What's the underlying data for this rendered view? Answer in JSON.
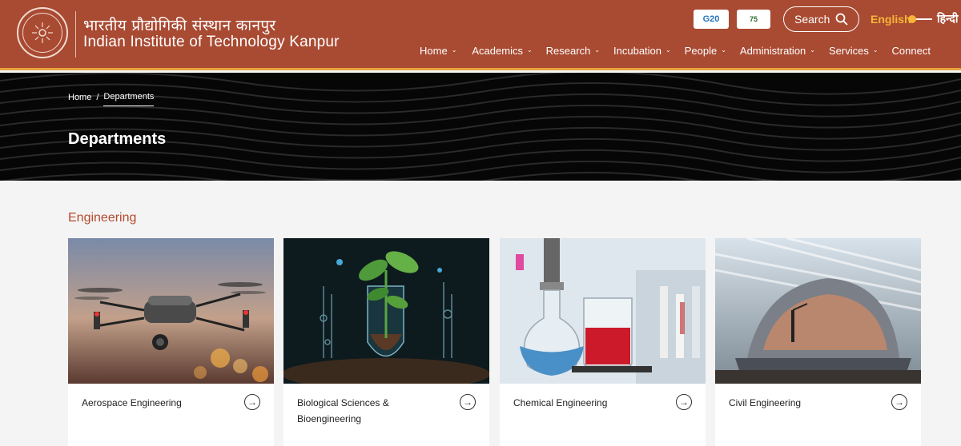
{
  "header": {
    "institute_hindi": "भारतीय प्रौद्योगिकी संस्थान कानपुर",
    "institute_english": "Indian Institute of Technology Kanpur",
    "badge_g20": "G20",
    "badge_azadi": "75",
    "search_label": "Search",
    "lang_english": "English",
    "lang_hindi": "हिन्दी",
    "nav": [
      {
        "label": "Home"
      },
      {
        "label": "Academics"
      },
      {
        "label": "Research"
      },
      {
        "label": "Incubation"
      },
      {
        "label": "People"
      },
      {
        "label": "Administration"
      },
      {
        "label": "Services"
      },
      {
        "label": "Connect"
      }
    ]
  },
  "hero": {
    "breadcrumb": {
      "home": "Home",
      "separator": "/",
      "current": "Departments"
    },
    "title": "Departments"
  },
  "section": {
    "title": "Engineering",
    "cards": [
      {
        "label": "Aerospace Engineering",
        "image": "drone"
      },
      {
        "label": "Biological Sciences & Bioengineering",
        "image": "plant-lab"
      },
      {
        "label": "Chemical Engineering",
        "image": "flasks"
      },
      {
        "label": "Civil Engineering",
        "image": "hard-hat"
      }
    ]
  },
  "colors": {
    "brand": "#a94a32",
    "accent": "#f7b53a",
    "section_title": "#b24a2c"
  }
}
